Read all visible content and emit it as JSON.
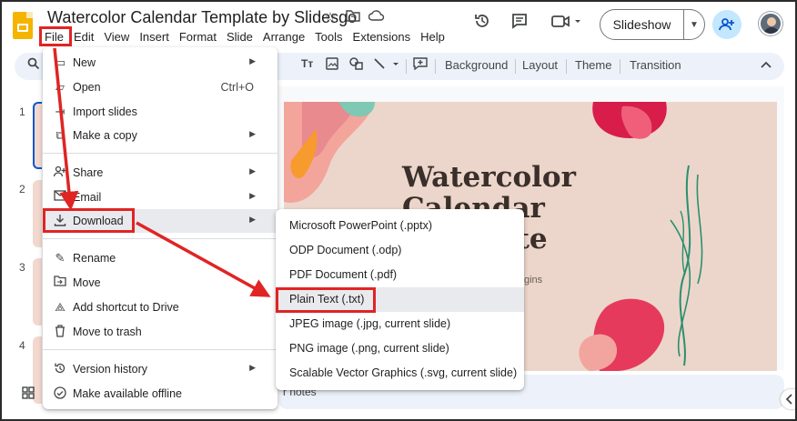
{
  "app": {
    "doc_title": "Watercolor Calendar Template by Slidesgo",
    "title_icons": [
      "star-icon",
      "move-to-folder-icon",
      "cloud-saved-icon"
    ]
  },
  "menubar": [
    "File",
    "Edit",
    "View",
    "Insert",
    "Format",
    "Slide",
    "Arrange",
    "Tools",
    "Extensions",
    "Help"
  ],
  "header": {
    "slideshow_label": "Slideshow",
    "icons": [
      "history-icon",
      "comment-icon",
      "video-call-icon",
      "share-icon"
    ]
  },
  "toolbar": {
    "background": "Background",
    "layout": "Layout",
    "theme": "Theme",
    "transition": "Transition"
  },
  "filmstrip": [
    "1",
    "2",
    "3",
    "4"
  ],
  "slide": {
    "title": "Watercolor\nCalendar\nTemplate",
    "subtitle": "ion begins"
  },
  "notes_label": "r notes",
  "file_menu": [
    {
      "label": "New",
      "icon": "new-icon",
      "submenu": true
    },
    {
      "label": "Open",
      "icon": "open-folder-icon",
      "shortcut": "Ctrl+O"
    },
    {
      "label": "Import slides",
      "icon": "import-icon"
    },
    {
      "label": "Make a copy",
      "icon": "copy-icon",
      "submenu": true
    },
    {
      "label": "Share",
      "icon": "share-person-icon",
      "submenu": true
    },
    {
      "label": "Email",
      "icon": "email-icon",
      "submenu": true
    },
    {
      "label": "Download",
      "icon": "download-icon",
      "submenu": true,
      "highlighted": true
    },
    {
      "label": "Rename",
      "icon": "rename-icon"
    },
    {
      "label": "Move",
      "icon": "move-icon"
    },
    {
      "label": "Add shortcut to Drive",
      "icon": "drive-shortcut-icon"
    },
    {
      "label": "Move to trash",
      "icon": "trash-icon"
    },
    {
      "label": "Version history",
      "icon": "version-history-icon",
      "submenu": true
    },
    {
      "label": "Make available offline",
      "icon": "offline-icon"
    }
  ],
  "download_menu": [
    "Microsoft PowerPoint (.pptx)",
    "ODP Document (.odp)",
    "PDF Document (.pdf)",
    "Plain Text (.txt)",
    "JPEG image (.jpg, current slide)",
    "PNG image (.png, current slide)",
    "Scalable Vector Graphics (.svg, current slide)"
  ],
  "colors": {
    "annotation_red": "#e02424",
    "accent_blue": "#0b57d0",
    "slide_bg": "#ecd6cb",
    "toolbar_bg": "#edf2fa"
  }
}
